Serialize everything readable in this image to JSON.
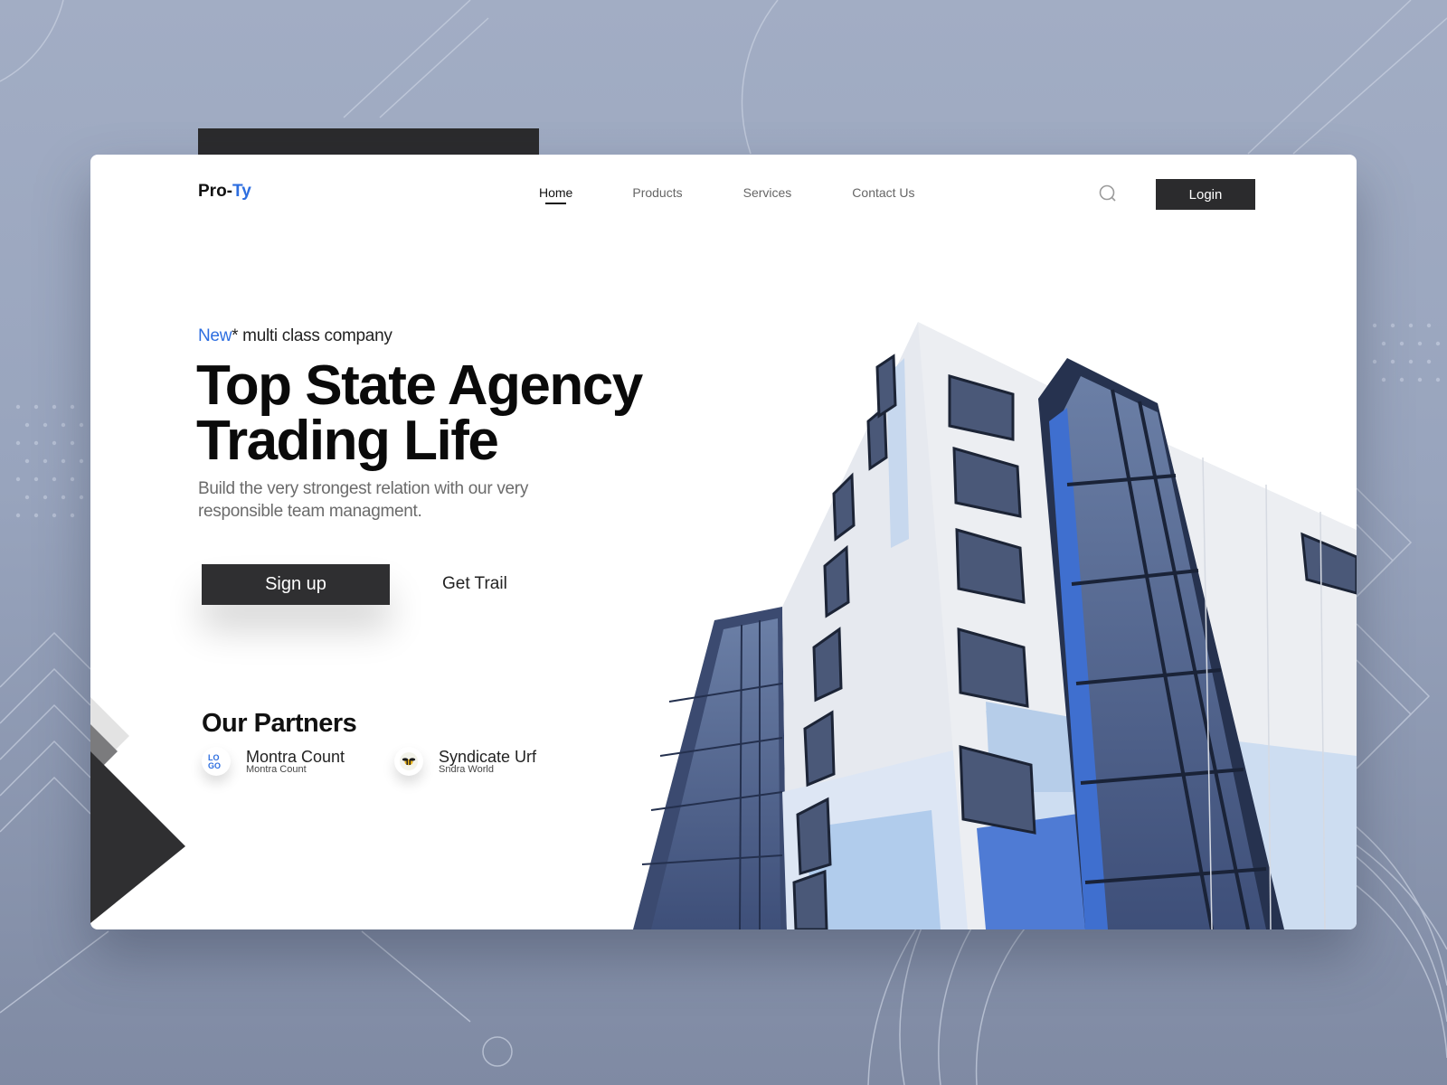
{
  "brand": {
    "prefix": "Pro-",
    "accent": "Ty"
  },
  "nav": {
    "items": [
      {
        "label": "Home",
        "active": true
      },
      {
        "label": "Products",
        "active": false
      },
      {
        "label": "Services",
        "active": false
      },
      {
        "label": "Contact Us",
        "active": false
      }
    ],
    "search_icon": "search-icon",
    "login_label": "Login"
  },
  "hero": {
    "tag_new": "New",
    "tag_rest": "* multi class company",
    "headline_line1": "Top State Agency",
    "headline_line2": "Trading Life",
    "subtext": "Build the very strongest relation with our very responsible team managment.",
    "signup_label": "Sign up",
    "trail_label": "Get Trail"
  },
  "partners": {
    "title": "Our Partners",
    "items": [
      {
        "name": "Montra Count",
        "sub": "Montra Count",
        "icon": "logo-icon",
        "logo_text": "LO GO"
      },
      {
        "name": "Syndicate Urf",
        "sub": "Sndra World",
        "icon": "bee-icon",
        "logo_text": ""
      }
    ]
  },
  "colors": {
    "accent": "#2d6ee0",
    "dark": "#2b2b2d",
    "background": "#a2adc4"
  }
}
